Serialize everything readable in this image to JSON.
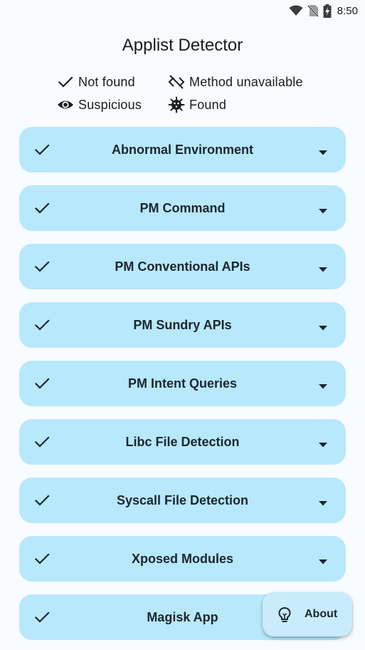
{
  "status_bar": {
    "time": "8:50",
    "icons": [
      "wifi-icon",
      "no-sim-icon",
      "battery-charging-icon"
    ]
  },
  "app": {
    "title": "Applist Detector"
  },
  "legend": {
    "not_found": {
      "icon": "check-icon",
      "label": "Not found"
    },
    "method_unavailable": {
      "icon": "code-off-icon",
      "label": "Method unavailable"
    },
    "suspicious": {
      "icon": "eye-icon",
      "label": "Suspicious"
    },
    "found": {
      "icon": "virus-icon",
      "label": "Found"
    }
  },
  "detections": [
    {
      "label": "Abnormal Environment",
      "status": "not_found"
    },
    {
      "label": "PM Command",
      "status": "not_found"
    },
    {
      "label": "PM Conventional APIs",
      "status": "not_found"
    },
    {
      "label": "PM Sundry APIs",
      "status": "not_found"
    },
    {
      "label": "PM Intent Queries",
      "status": "not_found"
    },
    {
      "label": "Libc File Detection",
      "status": "not_found"
    },
    {
      "label": "Syscall File Detection",
      "status": "not_found"
    },
    {
      "label": "Xposed Modules",
      "status": "not_found"
    },
    {
      "label": "Magisk App",
      "status": "not_found"
    }
  ],
  "fab": {
    "icon": "lightbulb-icon",
    "label": "About"
  },
  "colors": {
    "background": "#f8fbff",
    "card": "#b8e8fb",
    "fab": "#c8ecfb",
    "text": "#1a1c1e"
  }
}
